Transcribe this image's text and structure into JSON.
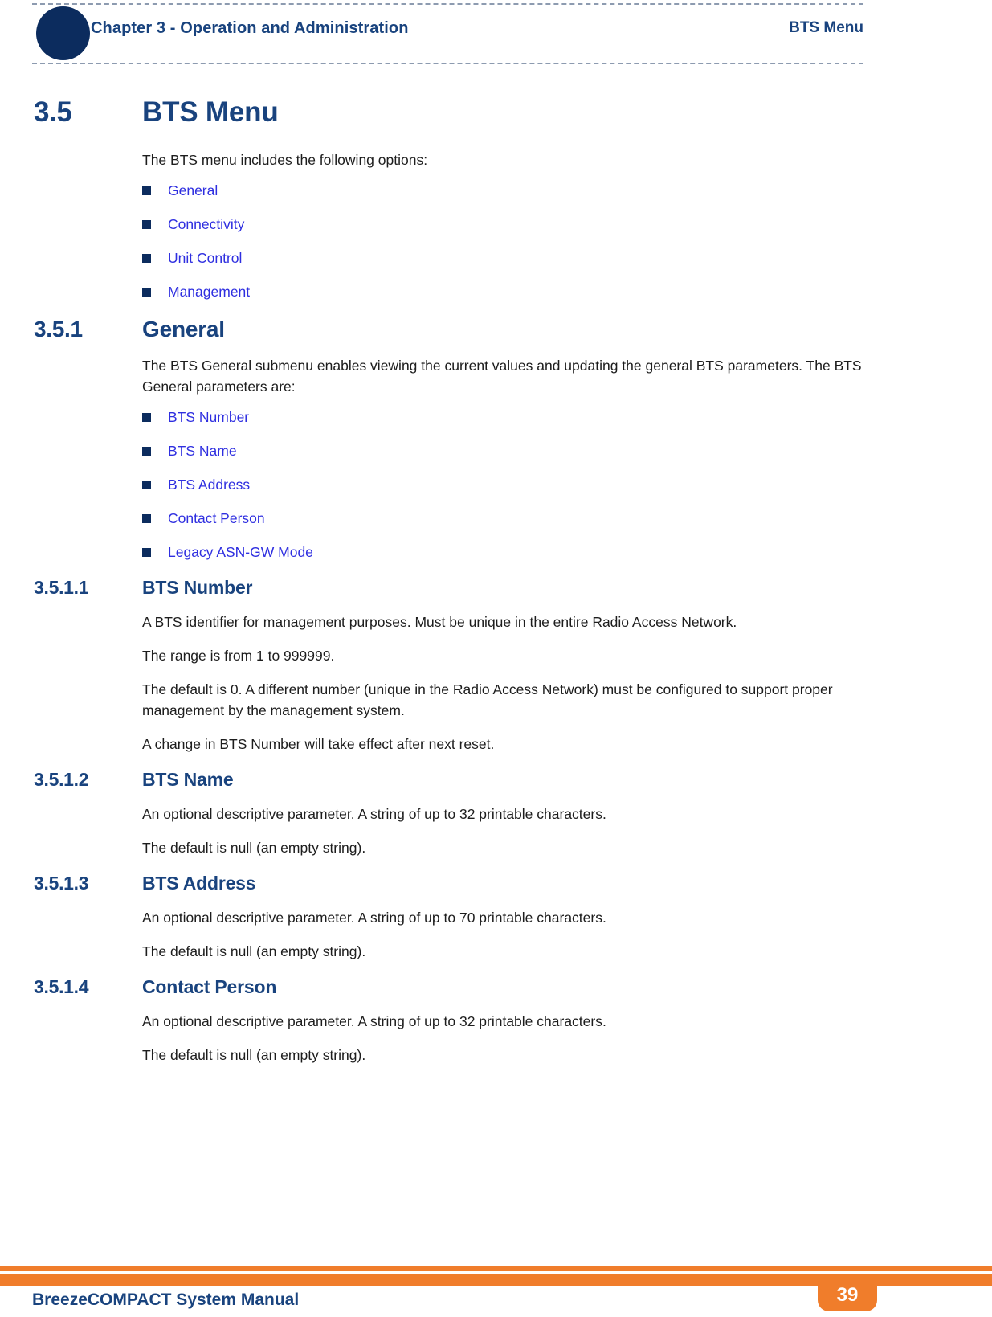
{
  "header": {
    "chapter": "Chapter 3 - Operation and Administration",
    "section": "BTS Menu"
  },
  "colors": {
    "navy": "#0c2c5e",
    "heading_blue": "#19437e",
    "link_blue": "#2f2fe0",
    "orange": "#f07d2b",
    "dash_gray": "#8d9bb0"
  },
  "sections": {
    "s35": {
      "number": "3.5",
      "title": "BTS Menu",
      "intro": "The BTS menu includes the following options:",
      "bullets": [
        {
          "label": "General"
        },
        {
          "label": "Connectivity"
        },
        {
          "label": "Unit Control"
        },
        {
          "label": "Management"
        }
      ]
    },
    "s351": {
      "number": "3.5.1",
      "title": "General",
      "intro": "The BTS General submenu enables viewing the current values and updating the general BTS parameters. The BTS General parameters are:",
      "bullets": [
        {
          "label": "BTS Number"
        },
        {
          "label": "BTS Name"
        },
        {
          "label": "BTS Address"
        },
        {
          "label": "Contact Person"
        },
        {
          "label": "Legacy ASN-GW Mode"
        }
      ]
    },
    "s3511": {
      "number": "3.5.1.1",
      "title": "BTS Number",
      "p1": "A BTS identifier for management purposes. Must be unique in the entire Radio Access Network.",
      "p2": "The range is from 1 to 999999.",
      "p3": "The default is 0. A different number (unique in the Radio Access Network) must be configured to support proper management by the management system.",
      "p4": "A change in BTS Number will take effect after next reset."
    },
    "s3512": {
      "number": "3.5.1.2",
      "title": "BTS Name",
      "p1": "An optional descriptive parameter. A string of up to 32 printable characters.",
      "p2": "The default is null (an empty string)."
    },
    "s3513": {
      "number": "3.5.1.3",
      "title": "BTS Address",
      "p1": "An optional descriptive parameter. A string of up to 70 printable characters.",
      "p2": "The default is null (an empty string)."
    },
    "s3514": {
      "number": "3.5.1.4",
      "title": "Contact Person",
      "p1": "An optional descriptive parameter. A string of up to 32 printable characters.",
      "p2": "The default is null (an empty string)."
    }
  },
  "footer": {
    "title": "BreezeCOMPACT System Manual",
    "page_number": "39"
  }
}
